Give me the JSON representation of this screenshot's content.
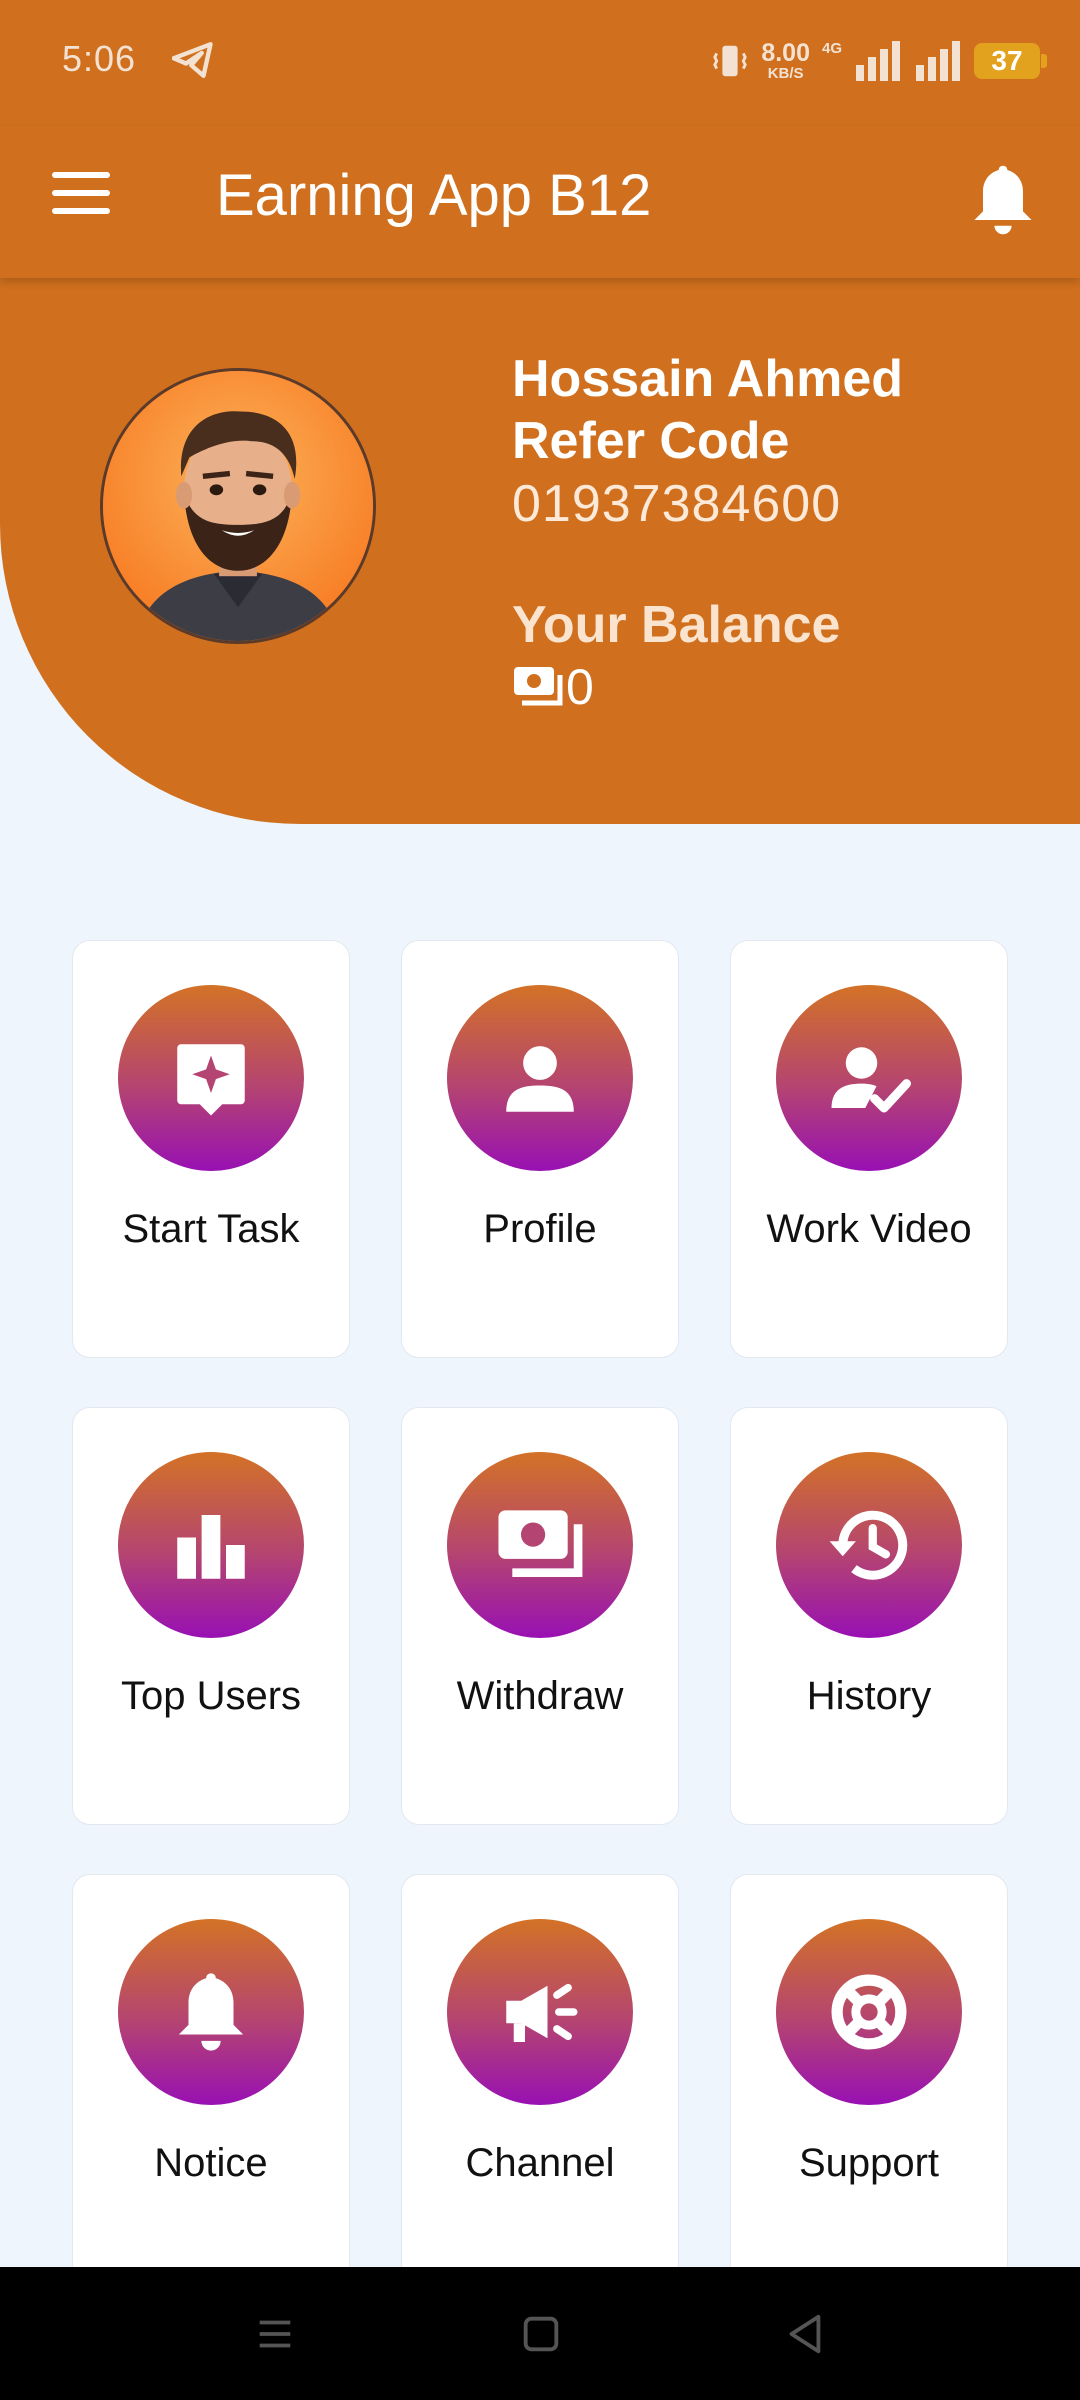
{
  "status_bar": {
    "time": "5:06",
    "net_speed_value": "8.00",
    "net_speed_unit": "KB/S",
    "network_type": "4G",
    "battery": "37"
  },
  "app_bar": {
    "title": "Earning App B12",
    "menu_icon": "hamburger-menu-icon",
    "notification_icon": "bell-icon"
  },
  "profile": {
    "name": "Hossain Ahmed",
    "refer_label": "Refer Code",
    "refer_code": "01937384600",
    "balance_label": "Your Balance",
    "balance_icon": "money-icon",
    "balance": "0"
  },
  "menu": [
    {
      "label": "Start Task",
      "icon": "task-star-icon"
    },
    {
      "label": "Profile",
      "icon": "person-icon"
    },
    {
      "label": "Work Video",
      "icon": "person-check-icon"
    },
    {
      "label": "Top Users",
      "icon": "bar-chart-icon"
    },
    {
      "label": "Withdraw",
      "icon": "money-icon"
    },
    {
      "label": "History",
      "icon": "history-icon"
    },
    {
      "label": "Notice",
      "icon": "bell-icon"
    },
    {
      "label": "Channel",
      "icon": "megaphone-icon"
    },
    {
      "label": "Support",
      "icon": "lifebuoy-icon"
    }
  ],
  "colors": {
    "primary": "#d0701e",
    "background": "#eef5fc",
    "gradient_top": "#d37226",
    "gradient_bottom": "#9810b3"
  }
}
